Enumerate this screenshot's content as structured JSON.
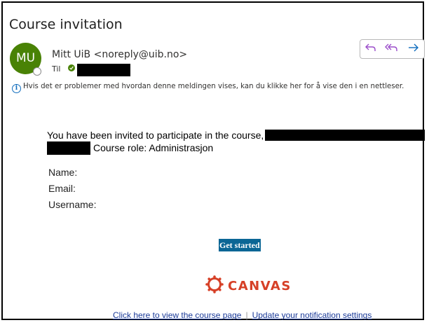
{
  "email": {
    "subject": "Course invitation",
    "sender": {
      "avatar_initials": "MU",
      "name_address": "Mitt UiB <noreply@uib.no>",
      "to_label": "Til"
    },
    "info_banner": "Hvis det er problemer med hvordan denne meldingen vises, kan du klikke her for å vise den i en nettleser.",
    "actions": [
      "reply-icon",
      "reply-all-icon",
      "forward-icon"
    ]
  },
  "content": {
    "invite_text": "You have been invited to participate in the course,",
    "course_role": "Course role: Administrasjon",
    "fields": {
      "name_label": "Name:",
      "email_label": "Email:",
      "username_label": "Username:"
    },
    "button_label": "Get started",
    "logo_text": "CANVAS",
    "footer": {
      "course_link": "Click here to view the course page",
      "separator": "|",
      "settings_link": "Update your notification settings"
    }
  },
  "colors": {
    "avatar_bg": "#498205",
    "button_bg": "#0b6695",
    "canvas_red": "#d64027",
    "link": "#1a3a99",
    "accent": "#0f6cbd"
  }
}
